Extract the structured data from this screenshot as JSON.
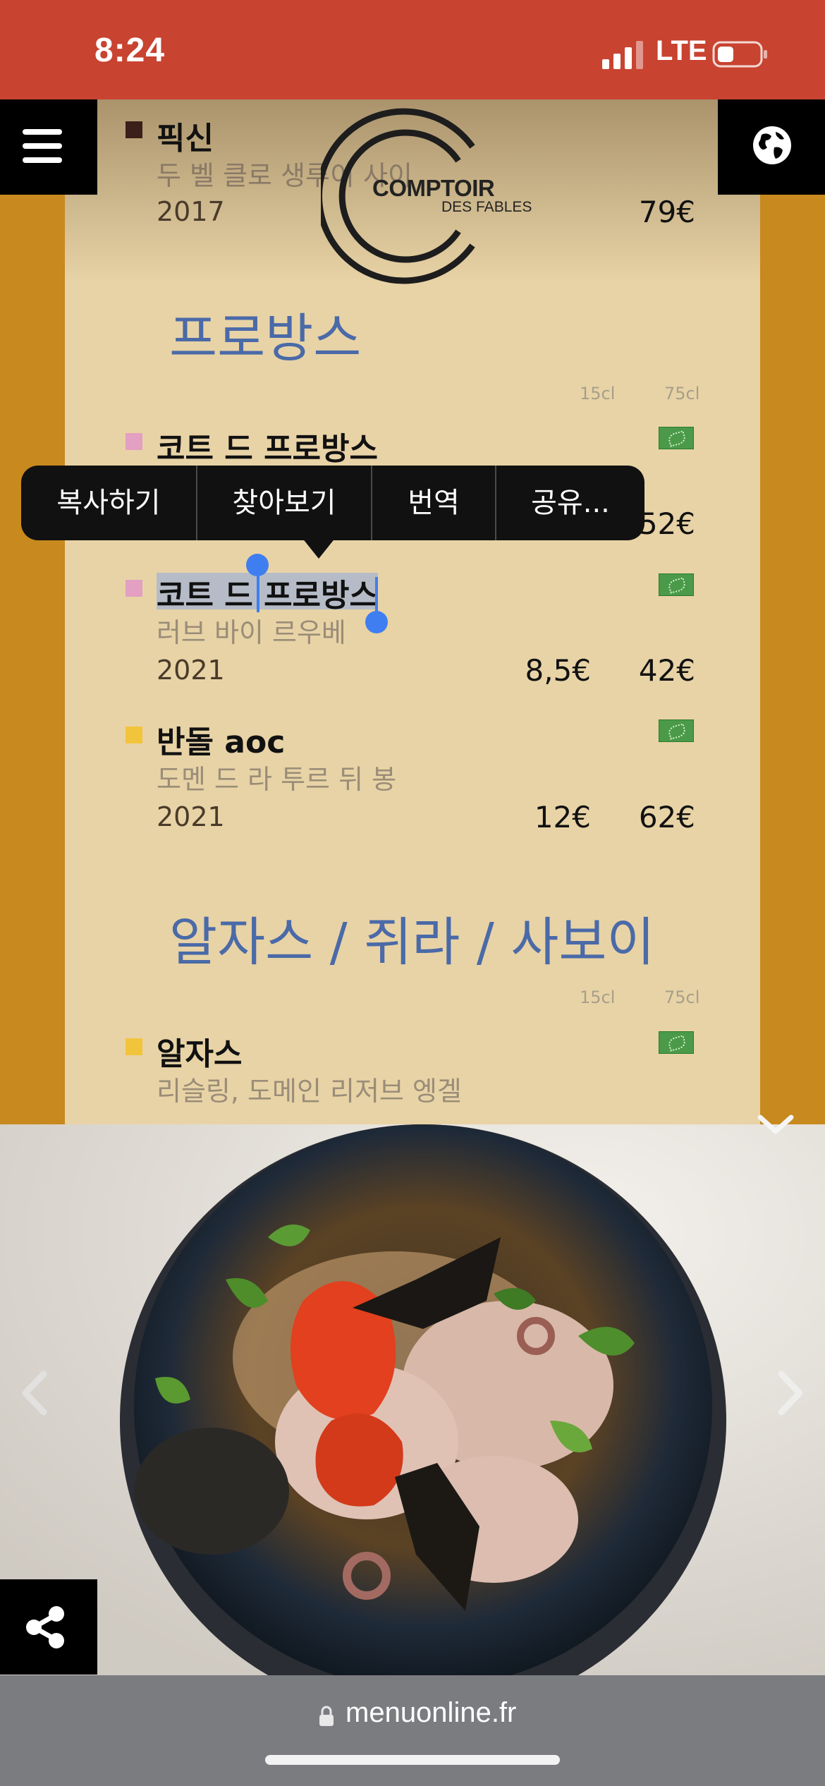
{
  "status_bar": {
    "time": "8:24",
    "network": "LTE",
    "signal_bars": 4,
    "battery_level": 0.3
  },
  "logo": {
    "line1": "COMPTOIR",
    "line2": "DES FABLES"
  },
  "menu": {
    "top_item": {
      "name": "픽신",
      "producer": "두 벨 클로 생루이 사이",
      "year": "2017",
      "price_75cl": "79€",
      "bullet_color": "#3a1f1a"
    },
    "sections": [
      {
        "title": "프로방스",
        "size_headers": [
          "15cl",
          "75cl"
        ],
        "items": [
          {
            "name": "코트 드 프로방스",
            "price_75cl": "52€",
            "bullet_color": "#e3a0c2",
            "organic": true
          },
          {
            "name": "코트 드 프로방스",
            "producer": "러브 바이 르우베",
            "year": "2021",
            "price_15cl": "8,5€",
            "price_75cl": "42€",
            "bullet_color": "#e3a0c2",
            "organic": true
          },
          {
            "name": "반돌 aoc",
            "producer": "도멘 드 라 투르 뒤 봉",
            "year": "2021",
            "price_15cl": "12€",
            "price_75cl": "62€",
            "bullet_color": "#f2c43b",
            "organic": true
          }
        ]
      },
      {
        "title": "알자스 / 쥐라 / 사보이",
        "size_headers": [
          "15cl",
          "75cl"
        ],
        "items": [
          {
            "name": "알자스",
            "producer": "리슬링, 도메인 리저브 엥겔",
            "bullet_color": "#f2c43b",
            "organic": true
          }
        ]
      }
    ]
  },
  "context_menu": {
    "items": [
      "복사하기",
      "찾아보기",
      "번역",
      "공유..."
    ]
  },
  "icons": {
    "menu": "hamburger-icon",
    "globe": "globe-icon",
    "share": "share-icon",
    "collapse": "chevron-down-icon",
    "prev": "chevron-left-icon",
    "next": "chevron-right-icon",
    "lock": "lock-icon"
  },
  "url_bar": {
    "url": "menuonline.fr"
  },
  "colors": {
    "status_bar": "#c84330",
    "page_bg": "#c8891e",
    "paper": "#e8d3a6",
    "section_title": "#4a6aa8",
    "organic_badge": "#4a9a4a"
  }
}
